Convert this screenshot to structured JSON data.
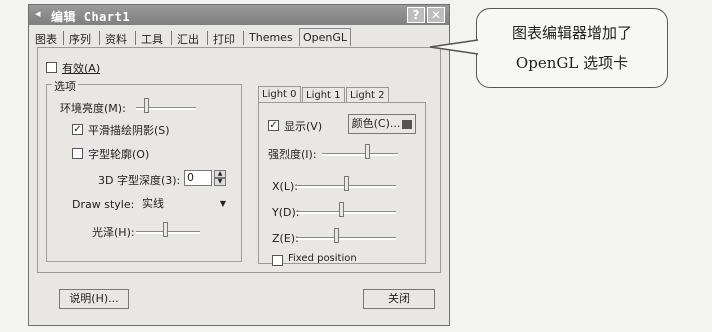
{
  "window": {
    "title": "编辑 Chart1",
    "help_glyph": "?",
    "close_glyph": "✕",
    "icon_glyph": "◂"
  },
  "tabs": [
    "图表",
    "序列",
    "资料",
    "工具",
    "汇出",
    "打印",
    "Themes",
    "OpenGL"
  ],
  "opengl": {
    "enable_label": "有效(A)",
    "enabled": false,
    "options_group_label": "选项",
    "ambient_label": "环境亮度(M):",
    "ambient_level": 0.15,
    "smooth_shadow_label": "平滑描绘阴影(S)",
    "smooth_shadow_checked": true,
    "font_outline_label": "字型轮廓(O)",
    "font_outline_checked": false,
    "depth_label": "3D 字型深度(3):",
    "depth_value": "0",
    "draw_style_label": "Draw style:",
    "draw_style_value": "实线",
    "gloss_label": "光泽(H):",
    "gloss_level": 0.45,
    "light_tabs": [
      "Light 0",
      "Light 1",
      "Light 2"
    ],
    "light": {
      "show_label": "显示(V)",
      "show_checked": true,
      "color_button": "颜色(C)...",
      "color_swatch": "#555555",
      "intensity_label": "强烈度(I):",
      "intensity_level": 0.6,
      "x_label": "X(L):",
      "x_level": 0.5,
      "y_label": "Y(D):",
      "y_level": 0.45,
      "z_label": "Z(E):",
      "z_level": 0.4,
      "fixed_label": "Fixed position",
      "fixed_checked": false
    }
  },
  "footer": {
    "help_button": "说明(H)...",
    "close_button": "关闭"
  },
  "callout": {
    "line1": "图表编辑器增加了",
    "line2": "OpenGL 选项卡"
  }
}
